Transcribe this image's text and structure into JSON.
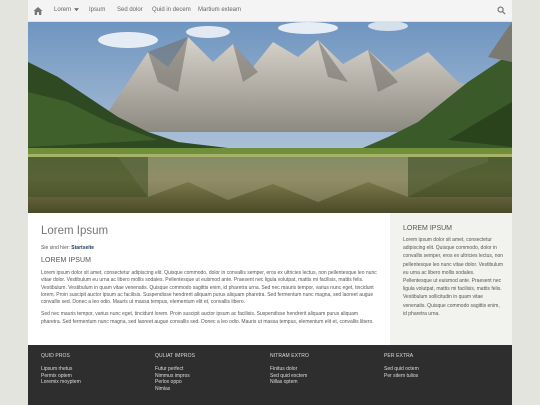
{
  "nav": {
    "items": [
      "Lorem",
      "Ipsum",
      "Sed dolor",
      "Quid in decem",
      "Martium exteam"
    ],
    "home_icon": "home-icon",
    "search_icon": "search-icon",
    "dropdown_icon": "caret-down-icon"
  },
  "hero": {
    "alt_icon": "mountain-lake-photo"
  },
  "main": {
    "title": "Lorem Ipsum",
    "breadcrumb_prefix": "Sie sind hier:",
    "breadcrumb_current": "Startseite",
    "heading": "LOREM IPSUM",
    "paragraph1": "Lorem ipsum dolor sit amet, consectetur adipiscing elit. Quisque commodo, dolor in convallis semper, eros ex ultricies lectus, non pellentesque leo nunc vitae dolor. Vestibulum eu urna ac libero mollis sodales. Pellentesque ut euismod ante. Praesent nec ligula volutpat, mattis mi facilisis, mattis felis. Vestibulum. Vestibulum in quam vitae venenatis. Quisque commodo sagittis enim, id pharetra urna. Sed nec mauris tempor, varius nunc eget, tincidunt lorem. Proin suscipit auctor ipsum ac facilisis. Suspendisse hendrerit aliquam purus aliquam pharetra. Sed fermentum nunc magna, sed laoreet augue convallis sed. Donec a leo odio. Mauris ut massa tempus, elementum elit et, convallis libero.",
    "paragraph2": "Sed nec mauris tempor, varius nunc eget, tincidunt lorem. Proin suscipit auctor ipsum ac facilisis. Suspendisse hendrerit aliquam purus aliquam pharetra. Sed fermentum nunc magna, sed laoreet augue convallis sed. Donec a leo odio. Mauris ut massa tempus, elementum elit et, convallis libero."
  },
  "sidebar": {
    "heading": "LOREM IPSUM",
    "text": "Lorem ipsum dolor sit amet, consectetur adipiscing elit. Quisque commodo, dolor in convallis semper, eros ex ultricies lectus, non pellentesque leo nunc vitae dolor. Vestibulum eu urna ac libero mollis sodales. Pellentesque ut euismod ante. Praesent nec ligula volutpat, mattis mi facilisis, mattis felis. Vestibulum sollicitudin in quam vitae venenatis. Quisque commodo sagittis enim, id pharetra urna."
  },
  "footer": {
    "columns": [
      {
        "heading": "QUID PROS",
        "links": [
          "Lipsum rhetus",
          "Permix optem",
          "Loremix moyptem"
        ]
      },
      {
        "heading": "QULIAT IMPROS",
        "links": [
          "Futur perfect",
          "Nimmus impros",
          "Perlox oppo",
          "Nimlas"
        ]
      },
      {
        "heading": "NITRAM EXTRO",
        "links": [
          "Finitus dolor",
          "Sed quid exctem",
          "Nillas optem"
        ]
      },
      {
        "heading": "PER EXTRA",
        "links": [
          "Sed quid octem",
          "Per sitem tulios"
        ]
      }
    ]
  },
  "colors": {
    "page_bg": "#e4e4df",
    "nav_bg": "#f4f4f4",
    "sidebar_bg": "#f2f2ee",
    "footer_bg": "#2e2e2e",
    "link_color": "#1f3f63"
  }
}
